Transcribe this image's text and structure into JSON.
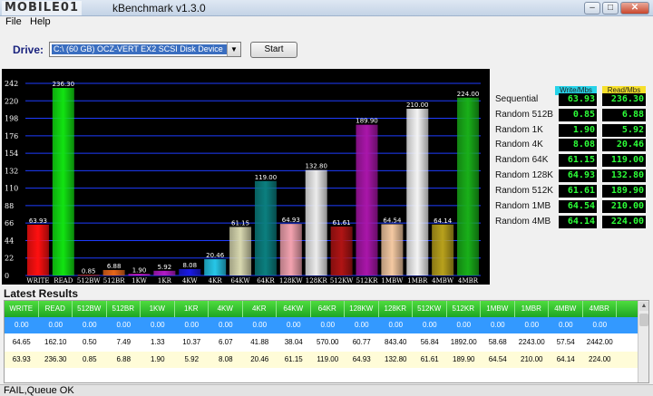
{
  "window": {
    "logo_text": "MOBILE01",
    "title": "kBenchmark v1.3.0"
  },
  "menu": [
    "File",
    "Help"
  ],
  "drive": {
    "label": "Drive:",
    "selected": "C:\\ (60 GB) OCZ-VERT EX2 SCSI Disk Device",
    "start_label": "Start"
  },
  "colors": {
    "accent_write": "#27d3e9",
    "accent_read": "#f6df2a",
    "value_green": "#2cff38",
    "grid_blue": "#1e3cff",
    "header_green": "#2fbf2a"
  },
  "chart_data": {
    "type": "bar",
    "categories": [
      "WRITE",
      "READ",
      "512BW",
      "512BR",
      "1KW",
      "1KR",
      "4KW",
      "4KR",
      "64KW",
      "64KR",
      "128KW",
      "128KR",
      "512KW",
      "512KR",
      "1MBW",
      "1MBR",
      "4MBW",
      "4MBR"
    ],
    "values": [
      63.93,
      236.3,
      0.85,
      6.88,
      1.9,
      5.92,
      8.08,
      20.46,
      61.15,
      119.0,
      64.93,
      132.8,
      61.61,
      189.9,
      64.54,
      210.0,
      64.14,
      224.0
    ],
    "value_labels": [
      "63.93",
      "236.30",
      "0.85",
      "6.88",
      "1.90",
      "5.92",
      "8.08",
      "20.46",
      "61.15",
      "119.00",
      "64.93",
      "132.80",
      "61.61",
      "189.90",
      "64.54",
      "210.00",
      "64.14",
      "224.00"
    ],
    "bar_colors": [
      "#ff1010",
      "#12e312",
      "#e83a1a",
      "#e6661a",
      "#e51ce5",
      "#b21bc8",
      "#1a1ae6",
      "#26c7e8",
      "#d8d8b0",
      "#0b7f7f",
      "#f3a3b0",
      "#ececec",
      "#b01414",
      "#aa16aa",
      "#f4c9a2",
      "#f4f4f4",
      "#b8a11c",
      "#19b019"
    ],
    "yticks": [
      "0",
      "22",
      "44",
      "66",
      "88",
      "110",
      "132",
      "154",
      "176",
      "198",
      "220",
      "242"
    ],
    "ylim": [
      0,
      242
    ],
    "grid": true
  },
  "results": {
    "headers": [
      "Write/Mbs",
      "Read/Mbs"
    ],
    "rows": [
      {
        "label": "Sequential",
        "write": "63.93",
        "read": "236.30"
      },
      {
        "label": "Random 512B",
        "write": "0.85",
        "read": "6.88"
      },
      {
        "label": "Random 1K",
        "write": "1.90",
        "read": "5.92"
      },
      {
        "label": "Random 4K",
        "write": "8.08",
        "read": "20.46"
      },
      {
        "label": "Random 64K",
        "write": "61.15",
        "read": "119.00"
      },
      {
        "label": "Random 128K",
        "write": "64.93",
        "read": "132.80"
      },
      {
        "label": "Random 512K",
        "write": "61.61",
        "read": "189.90"
      },
      {
        "label": "Random 1MB",
        "write": "64.54",
        "read": "210.00"
      },
      {
        "label": "Random 4MB",
        "write": "64.14",
        "read": "224.00"
      }
    ]
  },
  "latest": {
    "title": "Latest Results",
    "columns": [
      "WRITE",
      "READ",
      "512BW",
      "512BR",
      "1KW",
      "1KR",
      "4KW",
      "4KR",
      "64KW",
      "64KR",
      "128KW",
      "128KR",
      "512KW",
      "512KR",
      "1MBW",
      "1MBR",
      "4MBW",
      "4MBR"
    ],
    "rows": [
      [
        "0.00",
        "0.00",
        "0.00",
        "0.00",
        "0.00",
        "0.00",
        "0.00",
        "0.00",
        "0.00",
        "0.00",
        "0.00",
        "0.00",
        "0.00",
        "0.00",
        "0.00",
        "0.00",
        "0.00",
        "0.00"
      ],
      [
        "64.65",
        "162.10",
        "0.50",
        "7.49",
        "1.33",
        "10.37",
        "6.07",
        "41.88",
        "38.04",
        "570.00",
        "60.77",
        "843.40",
        "56.84",
        "1892.00",
        "58.68",
        "2243.00",
        "57.54",
        "2442.00"
      ],
      [
        "63.93",
        "236.30",
        "0.85",
        "6.88",
        "1.90",
        "5.92",
        "8.08",
        "20.46",
        "61.15",
        "119.00",
        "64.93",
        "132.80",
        "61.61",
        "189.90",
        "64.54",
        "210.00",
        "64.14",
        "224.00"
      ]
    ]
  },
  "status": "FAIL,Queue OK"
}
